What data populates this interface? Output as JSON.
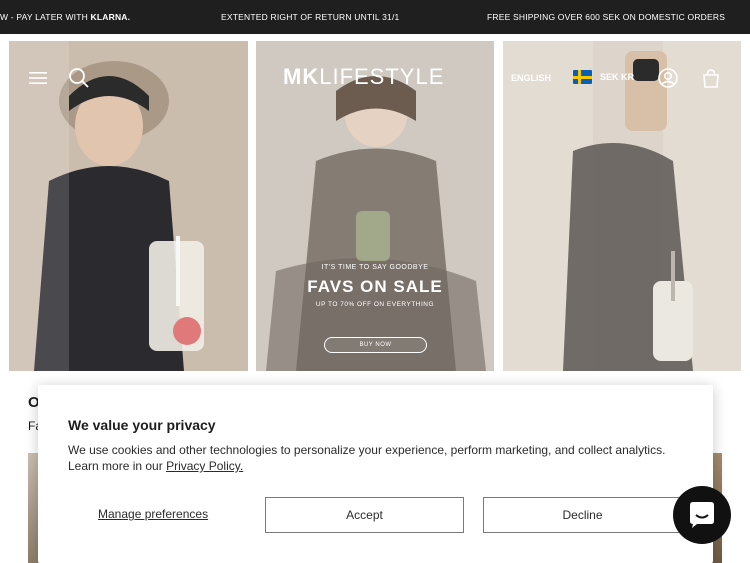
{
  "announcement": {
    "item1_text": "W - PAY LATER WITH ",
    "item1_bold": "KLARNA.",
    "item2": "EXTENTED RIGHT OF RETURN UNTIL 31/1",
    "item3": "FREE SHIPPING OVER 600 SEK ON DOMESTIC ORDERS"
  },
  "header": {
    "logo_bold": "MK",
    "logo_rest": "LIFESTYLE",
    "language": "ENGLISH",
    "currency": "SEK KR",
    "icons": [
      "menu-icon",
      "search-icon",
      "account-icon",
      "cart-icon"
    ]
  },
  "hero": {
    "sale": {
      "line1": "IT'S TIME TO SAY GOODBYE",
      "headline": "FAVS ON SALE",
      "line2": "UP TO 70% OFF ON EVERYTHING",
      "button": "BUY NOW"
    }
  },
  "behind": {
    "title": "O",
    "subtitle": "Fa"
  },
  "privacy": {
    "title": "We value your privacy",
    "body": "We use cookies and other technologies to personalize your experience, perform marketing, and collect analytics. Learn more in our ",
    "link": "Privacy Policy.",
    "manage": "Manage preferences",
    "accept": "Accept",
    "decline": "Decline"
  },
  "colors": {
    "announcement_bg": "#1f1f1f",
    "chat_bg": "#111111"
  }
}
